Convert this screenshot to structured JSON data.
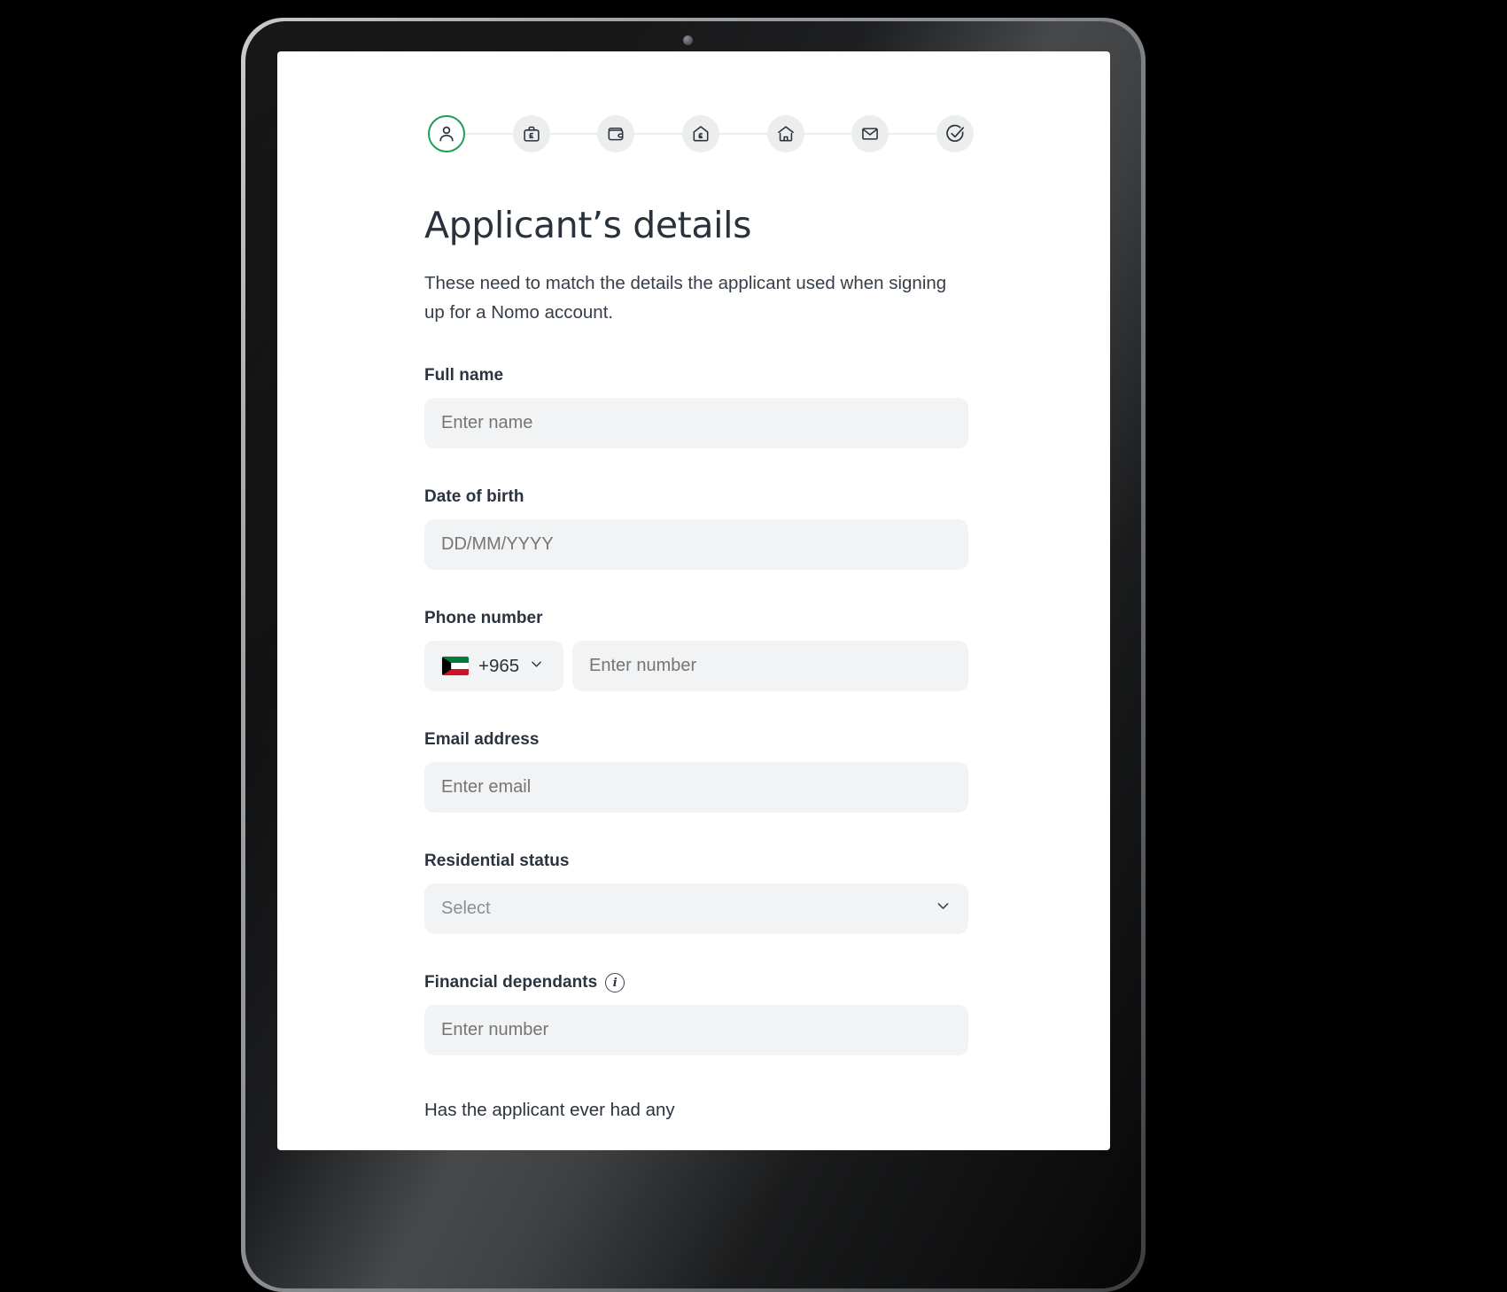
{
  "device": {
    "type": "tablet",
    "camera": "camera-dot"
  },
  "stepper": {
    "steps": [
      {
        "id": "applicant",
        "icon": "person-icon",
        "state": "active"
      },
      {
        "id": "employment",
        "icon": "briefcase-pound-icon",
        "state": "inactive"
      },
      {
        "id": "income",
        "icon": "wallet-icon",
        "state": "inactive"
      },
      {
        "id": "affordability",
        "icon": "house-pound-icon",
        "state": "inactive"
      },
      {
        "id": "property",
        "icon": "home-icon",
        "state": "inactive"
      },
      {
        "id": "contact",
        "icon": "envelope-icon",
        "state": "inactive"
      },
      {
        "id": "review",
        "icon": "check-circle-icon",
        "state": "inactive"
      }
    ],
    "active_color": "#1f9d55",
    "inactive_bg": "#eceded"
  },
  "page": {
    "title": "Applicant’s details",
    "subtitle": "These need to match the details the applicant used when signing up for a Nomo account."
  },
  "form": {
    "full_name": {
      "label": "Full name",
      "placeholder": "Enter name",
      "value": ""
    },
    "date_of_birth": {
      "label": "Date of birth",
      "placeholder": "DD/MM/YYYY",
      "value": ""
    },
    "phone": {
      "label": "Phone number",
      "country_flag": "kuwait-flag",
      "dial_code": "+965",
      "placeholder": "Enter number",
      "value": "",
      "chevron": "chevron-down-icon"
    },
    "email": {
      "label": "Email address",
      "placeholder": "Enter email",
      "value": ""
    },
    "residential_status": {
      "label": "Residential status",
      "placeholder": "Select",
      "value": "",
      "chevron": "chevron-down-icon"
    },
    "financial_dependants": {
      "label": "Financial dependants",
      "info": "info-icon",
      "info_glyph": "i",
      "placeholder": "Enter number",
      "value": ""
    },
    "next_question": {
      "text": "Has the applicant ever had any"
    }
  },
  "colors": {
    "accent": "#1f9d55",
    "text": "#2b333e",
    "placeholder": "#8a8f96",
    "input_bg": "#f2f3f4",
    "screen_bg": "#ffffff"
  }
}
